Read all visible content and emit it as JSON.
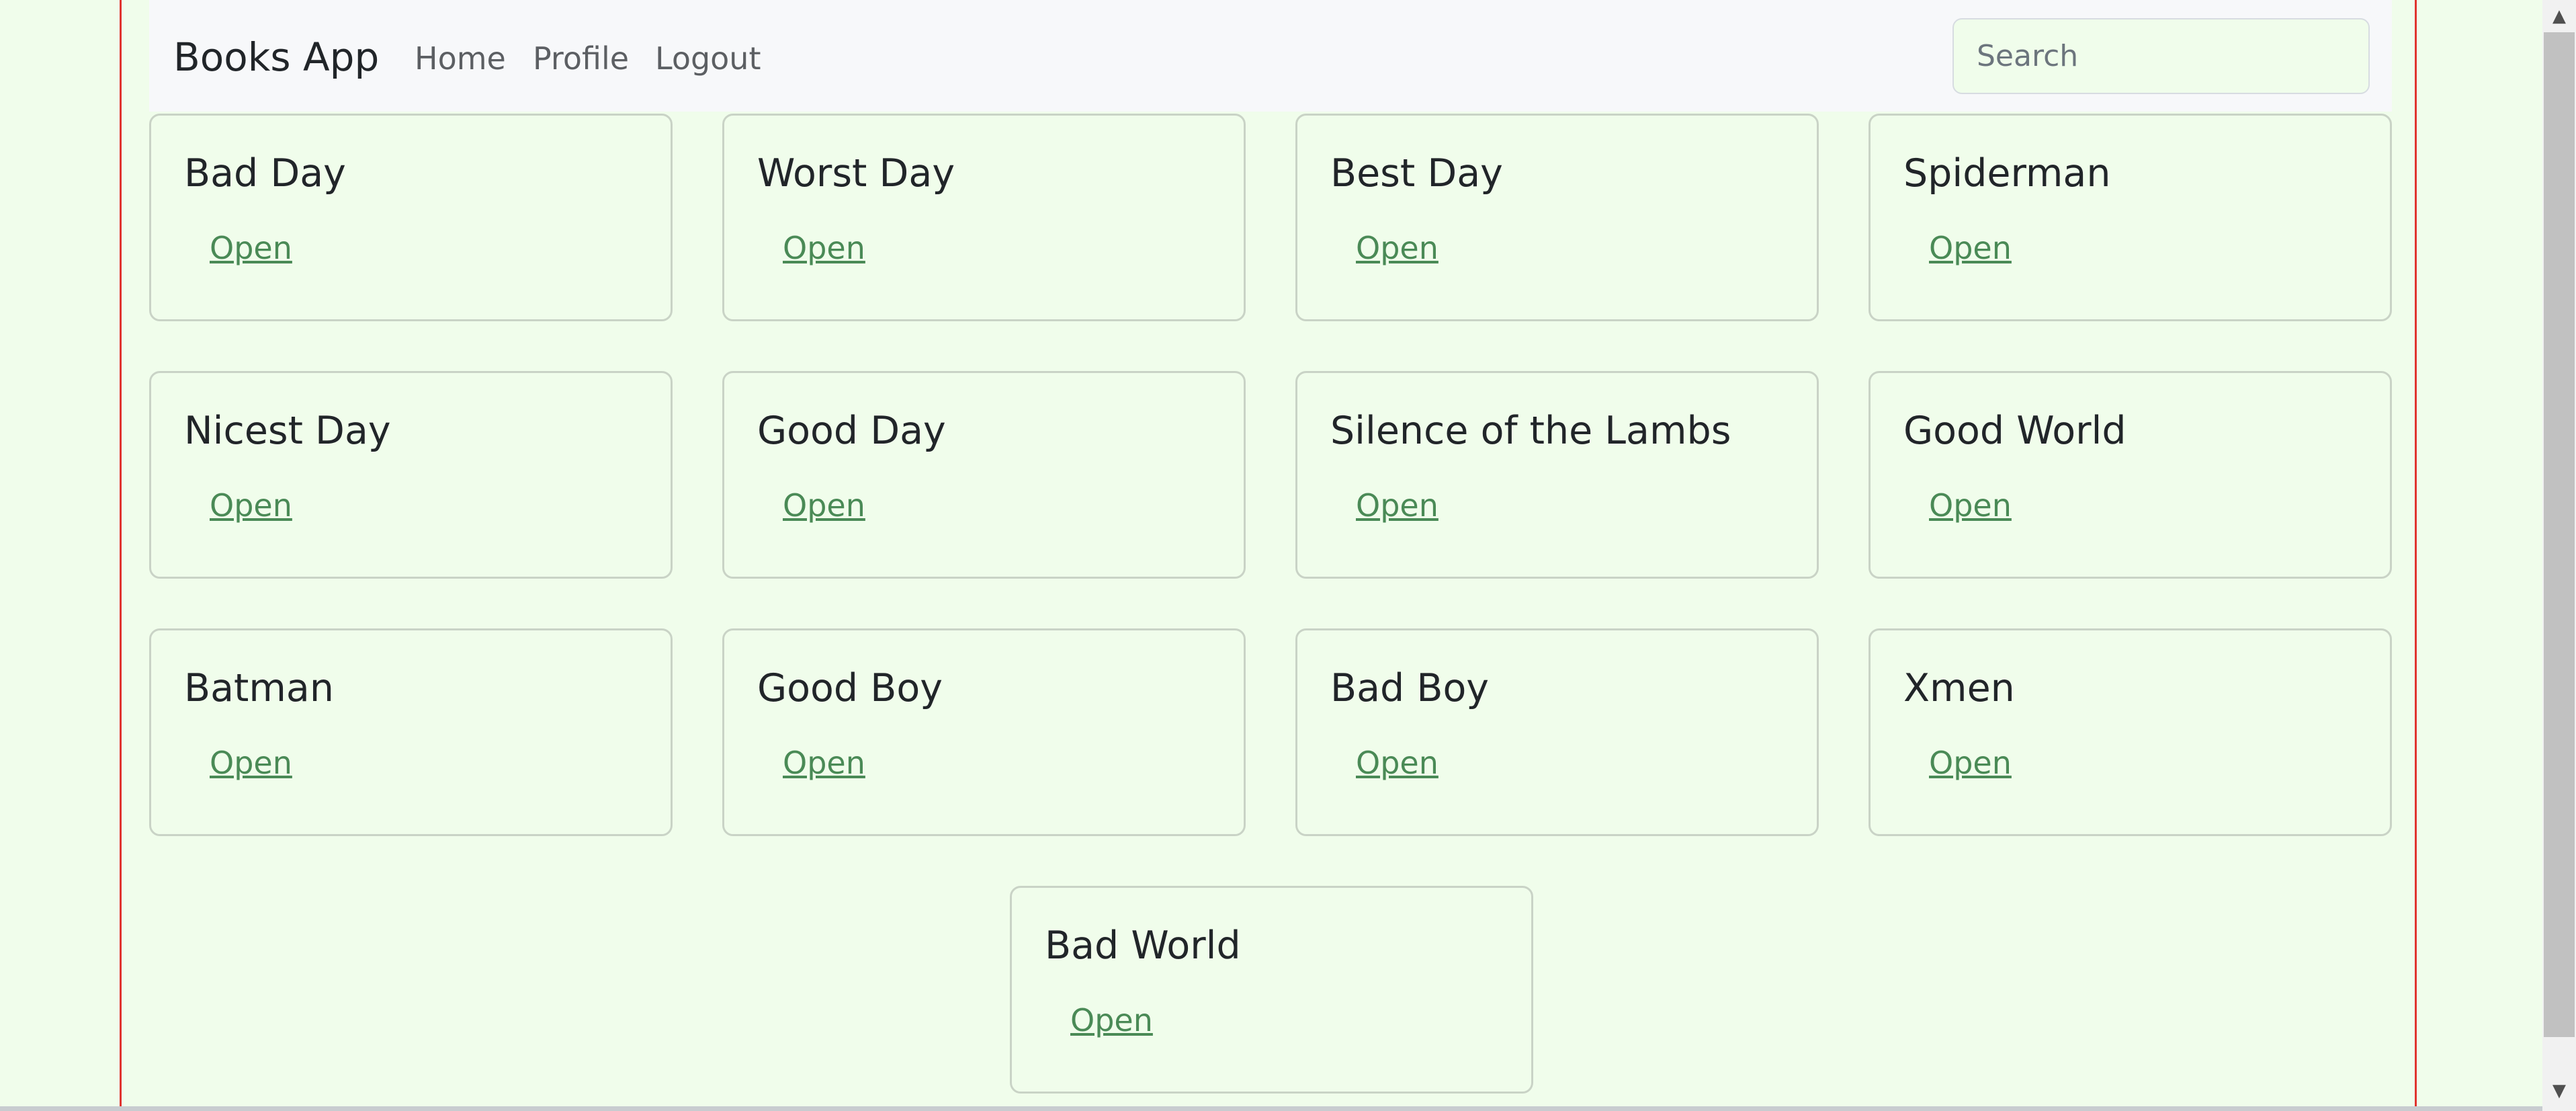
{
  "navbar": {
    "brand": "Books App",
    "links": [
      "Home",
      "Profile",
      "Logout"
    ],
    "search_placeholder": "Search"
  },
  "books": [
    {
      "title": "Bad Day",
      "link": "Open"
    },
    {
      "title": "Worst Day",
      "link": "Open"
    },
    {
      "title": "Best Day",
      "link": "Open"
    },
    {
      "title": "Spiderman",
      "link": "Open"
    },
    {
      "title": "Nicest Day",
      "link": "Open"
    },
    {
      "title": "Good Day",
      "link": "Open"
    },
    {
      "title": "Silence of the Lambs",
      "link": "Open"
    },
    {
      "title": "Good World",
      "link": "Open"
    },
    {
      "title": "Batman",
      "link": "Open"
    },
    {
      "title": "Good Boy",
      "link": "Open"
    },
    {
      "title": "Bad Boy",
      "link": "Open"
    },
    {
      "title": "Xmen",
      "link": "Open"
    },
    {
      "title": "Bad World",
      "link": "Open"
    }
  ],
  "colors": {
    "page_background": "#f0fdeb",
    "navbar_background": "#f7f8fa",
    "container_border": "#e0342f",
    "link": "#4a8a56",
    "card_border": "#c9d3c6"
  },
  "icons": {
    "scroll_up": "triangle-up-icon",
    "scroll_down": "triangle-down-icon"
  }
}
